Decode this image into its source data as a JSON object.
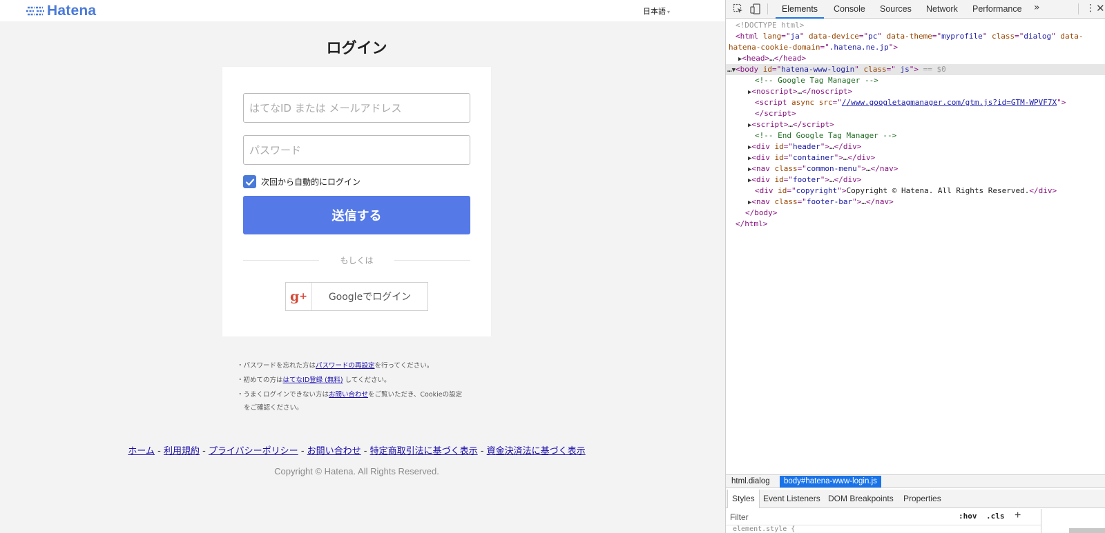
{
  "page": {
    "logo_text": "Hatena",
    "language": "日本語",
    "title": "ログイン",
    "id_placeholder": "はてなID または メールアドレス",
    "password_placeholder": "パスワード",
    "remember_label": "次回から自動的にログイン",
    "submit_label": "送信する",
    "or_label": "もしくは",
    "google_label": "Googleでログイン",
    "notes": [
      {
        "before": "・パスワードを忘れた方は",
        "link": "パスワードの再設定",
        "after": "を行ってください。"
      },
      {
        "before": "・初めての方は",
        "link": "はてなID登録 (無料)",
        "after": " してください。"
      },
      {
        "before": "・うまくログインできない方は",
        "link": "お問い合わせ",
        "after": "をご覧いただき、Cookieの設定"
      },
      {
        "before": "をご確認ください。",
        "link": "",
        "after": ""
      }
    ],
    "footer_links": [
      "ホーム",
      "利用規約",
      "プライバシーポリシー",
      "お問い合わせ",
      "特定商取引法に基づく表示",
      "資金決済法に基づく表示"
    ],
    "footer_sep": " - ",
    "copyright": "Copyright © Hatena. All Rights Reserved."
  },
  "devtools": {
    "tabs": [
      "Elements",
      "Console",
      "Sources",
      "Network",
      "Performance"
    ],
    "active_tab": "Elements",
    "more": "»",
    "kebab": "⋮",
    "close": "✕",
    "breadcrumbs": [
      "html.dialog",
      "body#hatena-www-login.js"
    ],
    "sub_tabs": [
      "Styles",
      "Event Listeners",
      "DOM Breakpoints",
      "Properties"
    ],
    "filter_placeholder": "Filter",
    "hov": ":hov",
    "cls": ".cls",
    "add": "+",
    "styles_stub": "element.style {"
  },
  "icons": {
    "inspect": "inspect-element-icon",
    "device": "device-toolbar-icon",
    "check": "check-icon",
    "google_plus": "google-plus-icon",
    "logo": "hatena-logo-icon"
  },
  "colors": {
    "brand": "#4a7ad8",
    "submit_bg": "#5579e7",
    "google_red": "#d34836",
    "devtools_accent": "#1a73e8",
    "page_bg": "#f3f3f3"
  }
}
